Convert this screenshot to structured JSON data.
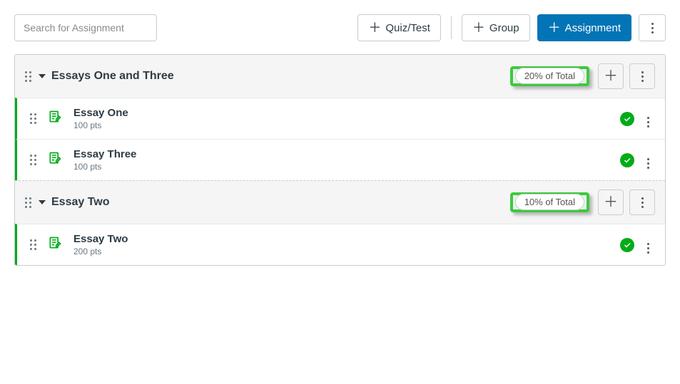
{
  "search": {
    "placeholder": "Search for Assignment"
  },
  "toolbar": {
    "quiz": "Quiz/Test",
    "group": "Group",
    "assignment": "Assignment"
  },
  "groups": [
    {
      "title": "Essays One and Three",
      "weight": "20% of Total",
      "items": [
        {
          "title": "Essay One",
          "points": "100 pts"
        },
        {
          "title": "Essay Three",
          "points": "100 pts"
        }
      ]
    },
    {
      "title": "Essay Two",
      "weight": "10% of Total",
      "items": [
        {
          "title": "Essay Two",
          "points": "200 pts"
        }
      ]
    }
  ]
}
